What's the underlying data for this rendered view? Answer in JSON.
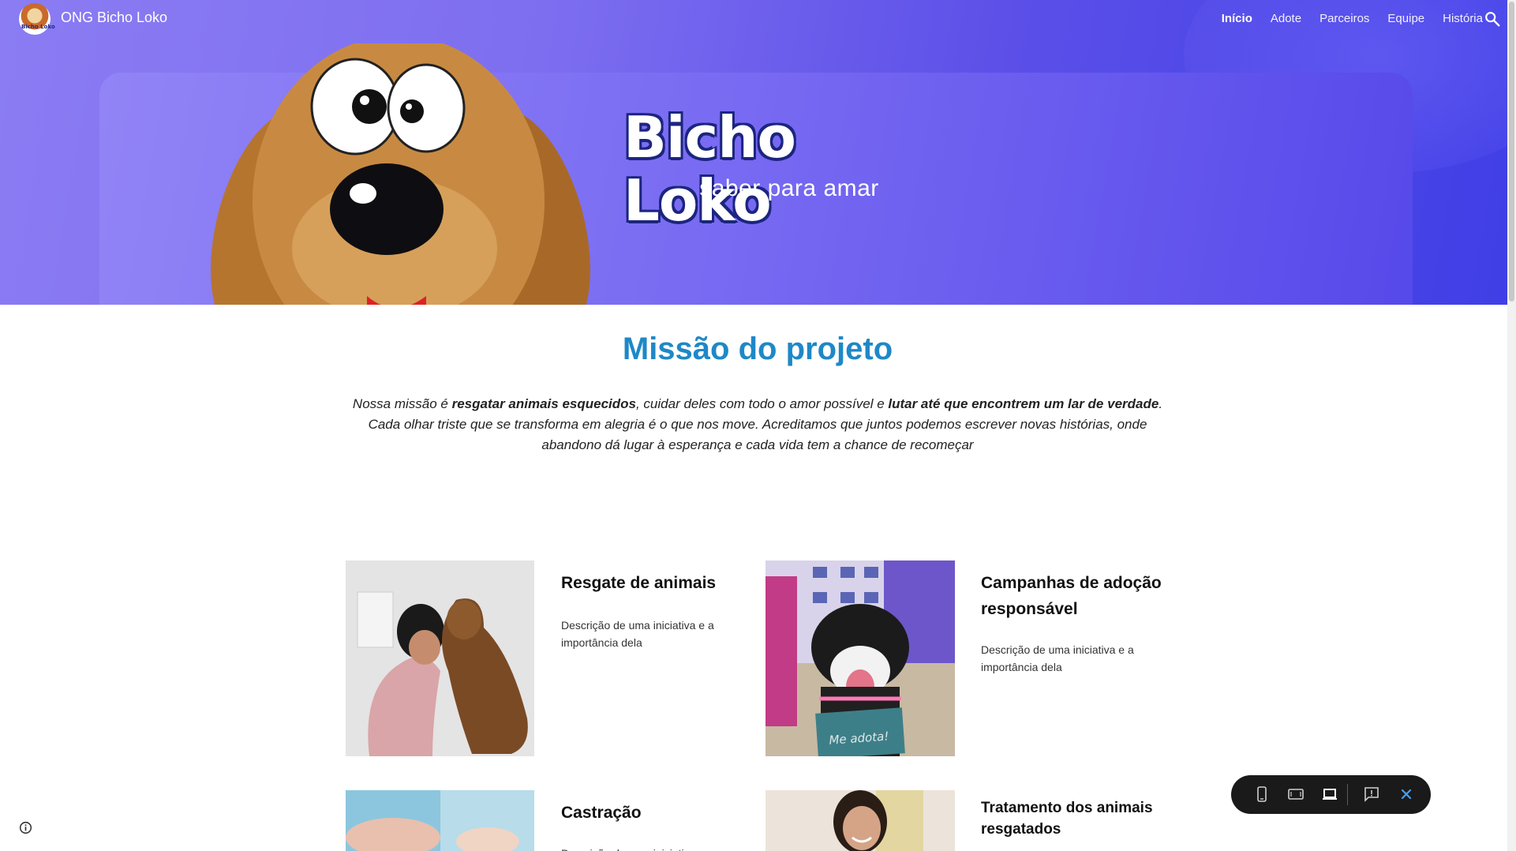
{
  "header": {
    "site_title": "ONG Bicho Loko",
    "logo_text": "Bicho Loko",
    "nav": [
      {
        "label": "Início"
      },
      {
        "label": "Adote"
      },
      {
        "label": "Parceiros"
      },
      {
        "label": "Equipe"
      },
      {
        "label": "História"
      }
    ]
  },
  "hero": {
    "brand": "Bicho Loko",
    "tagline": "saber para amar"
  },
  "mission": {
    "title": "Missão do projeto",
    "text_intro": "Nossa missão é ",
    "text_bold1": "resgatar animais esquecidos",
    "text_mid": ", cuidar deles com todo o amor possível e ",
    "text_bold2": "lutar até que encontrem um lar de verdade",
    "text_end": ". Cada olhar triste que se transforma em alegria é o que nos move. Acreditamos que juntos podemos escrever novas histórias, onde abandono dá lugar à esperança e cada vida tem a chance de recomeçar"
  },
  "cards": [
    {
      "title": "Resgate de animais",
      "desc": "Descrição de uma iniciativa e a importância dela"
    },
    {
      "title": "Campanhas de adoção responsável",
      "desc": "Descrição de uma iniciativa e a importância dela"
    },
    {
      "title": "Castração",
      "desc": "Descrição de uma iniciativa"
    },
    {
      "title": "Tratamento dos animais resgatados",
      "desc": ""
    }
  ],
  "sign": {
    "text": "Me adota!"
  },
  "colors": {
    "hero_start": "#8b7cf3",
    "hero_end": "#3f3ee6",
    "mission_title": "#1e88c7",
    "toolbar": "#1a1a1a",
    "close_accent": "#4a9df0"
  }
}
